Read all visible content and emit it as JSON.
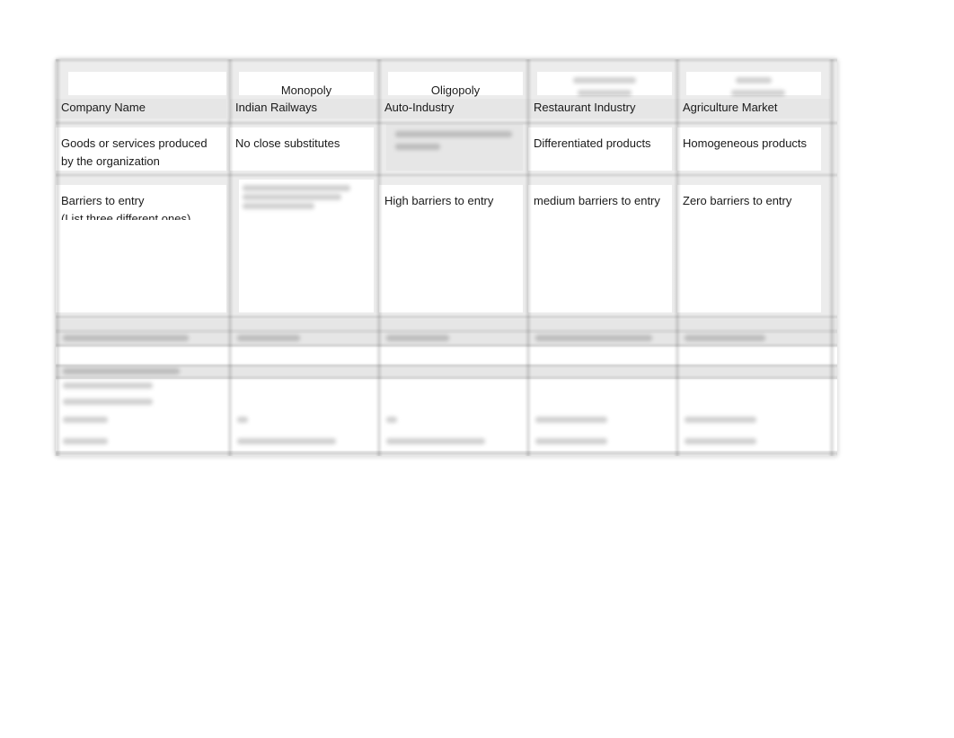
{
  "table": {
    "header": {
      "row_label": "",
      "columns": [
        "Monopoly",
        "Oligopoly",
        "",
        ""
      ]
    },
    "rows": [
      {
        "label": "Company Name",
        "values": [
          "Indian Railways",
          "Auto-Industry",
          "Restaurant Industry",
          "Agriculture Market"
        ]
      },
      {
        "label_line1": "Goods or services produced",
        "label_line2": "by the organization",
        "values": [
          "No close substitutes",
          "",
          "Differentiated products",
          "Homogeneous products"
        ]
      },
      {
        "label_line1": "Barriers to entry",
        "label_line2": "(List three different ones)",
        "values": [
          "",
          "High barriers to entry",
          "medium barriers to entry",
          "Zero barriers to entry"
        ]
      }
    ]
  }
}
